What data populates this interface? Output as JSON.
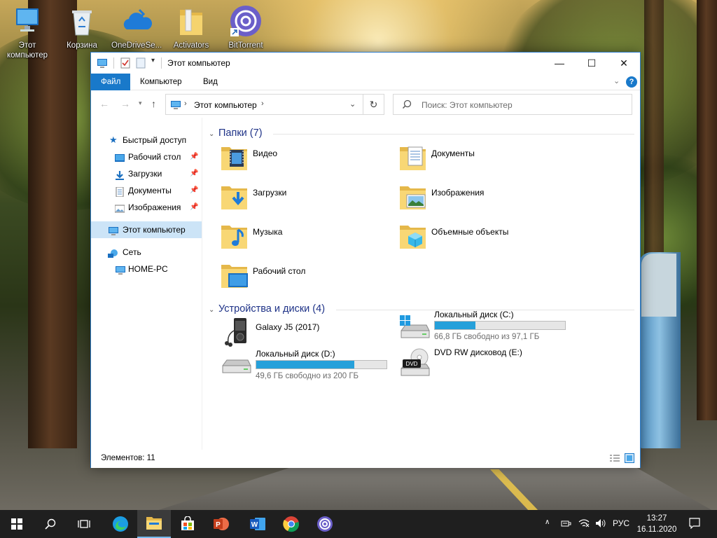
{
  "desktop": {
    "icons": [
      {
        "label": "Этот компьютер",
        "icon": "this-pc-icon"
      },
      {
        "label": "Корзина",
        "icon": "recycle-bin-icon"
      },
      {
        "label": "OneDriveSe...",
        "icon": "onedrive-icon"
      },
      {
        "label": "Activators",
        "icon": "folder-icon"
      },
      {
        "label": "BitTorrent",
        "icon": "bittorrent-icon"
      }
    ]
  },
  "window": {
    "title": "Этот компьютер",
    "controls": {
      "minimize": "—",
      "maximize": "☐",
      "close": "✕"
    },
    "ribbon": {
      "tabs": [
        "Файл",
        "Компьютер",
        "Вид"
      ],
      "active_tab": "Файл",
      "help": "?"
    },
    "address": {
      "path": "Этот компьютер"
    },
    "search": {
      "placeholder": "Поиск: Этот компьютер"
    },
    "nav_pane": {
      "quick_access": "Быстрый доступ",
      "pinned": [
        "Рабочий стол",
        "Загрузки",
        "Документы",
        "Изображения"
      ],
      "this_pc": "Этот компьютер",
      "network": "Сеть",
      "home_pc": "HOME-PC"
    },
    "folders_group": {
      "header": "Папки (7)",
      "items": [
        "Видео",
        "Документы",
        "Загрузки",
        "Изображения",
        "Музыка",
        "Объемные объекты",
        "Рабочий стол"
      ]
    },
    "devices_group": {
      "header": "Устройства и диски (4)",
      "items": [
        {
          "name": "Galaxy J5 (2017)",
          "type": "phone"
        },
        {
          "name": "Локальный диск (C:)",
          "free": "66,8 ГБ свободно из 97,1 ГБ",
          "used_fraction": 0.31
        },
        {
          "name": "Локальный диск (D:)",
          "free": "49,6 ГБ свободно из 200 ГБ",
          "used_fraction": 0.75
        },
        {
          "name": "DVD RW дисковод (E:)",
          "type": "dvd",
          "badge": "DVD"
        }
      ]
    },
    "status": "Элементов: 11"
  },
  "taskbar": {
    "language": "РУС",
    "time": "13:27",
    "date": "16.11.2020",
    "accent": "#76b9ed"
  }
}
